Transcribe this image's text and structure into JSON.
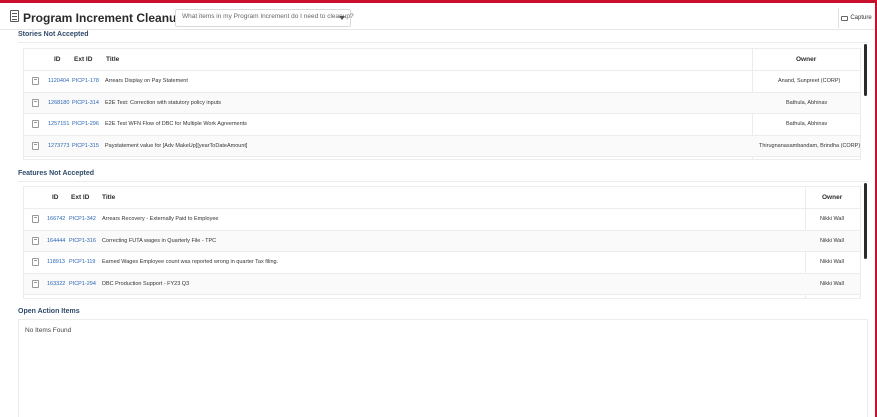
{
  "header": {
    "title": "Program Increment Cleanup Report",
    "dropdown_value": "What items in my Program Increment do I need to cleanup?",
    "capture_label": "Capture",
    "title_icon": "document-icon",
    "capture_icon": "camera-icon"
  },
  "stories": {
    "section_title": "Stories Not Accepted",
    "columns": {
      "id": "ID",
      "ext_id": "Ext ID",
      "title": "Title",
      "owner": "Owner"
    },
    "rows": [
      {
        "id": "1120404",
        "ext_id": "PICP1-178",
        "title": "Arrears Display on Pay Statement",
        "owner": "Anand, Sunpreet (CORP)"
      },
      {
        "id": "1268180",
        "ext_id": "PICP1-314",
        "title": "E2E Test: Correction with statutory policy inputs",
        "owner": "Bathula, Abhinav"
      },
      {
        "id": "1257151",
        "ext_id": "PICP1-296",
        "title": "E2E Test WFN Flow of DBC for Multiple Work Agreements",
        "owner": "Bathula, Abhinav"
      },
      {
        "id": "1273773",
        "ext_id": "PICP1-315",
        "title": "Paystatement value for [Adv MakeUp][yearToDateAmount]",
        "owner": "Thirugnanasambandam, Brindha (CORP)"
      }
    ]
  },
  "features": {
    "section_title": "Features Not Accepted",
    "columns": {
      "id": "ID",
      "ext_id": "Ext ID",
      "title": "Title",
      "owner": "Owner"
    },
    "rows": [
      {
        "id": "166742",
        "ext_id": "PICP1-342",
        "title": "Arrears Recovery - Externally Paid to Employee",
        "owner": "Nikki Wall"
      },
      {
        "id": "164444",
        "ext_id": "PICP1-316",
        "title": "Correcting FUTA wages in Quarterly File - TPC",
        "owner": "Nikki Wall"
      },
      {
        "id": "118913",
        "ext_id": "PICP1-119",
        "title": "Earned Wages Employee count was reported wrong in quarter Tax filing.",
        "owner": "Nikki Wall"
      },
      {
        "id": "163322",
        "ext_id": "PICP1-294",
        "title": "DBC Production Support - FY23 Q3",
        "owner": "Nikki Wall"
      }
    ]
  },
  "action_items": {
    "section_title": "Open Action Items",
    "empty_text": "No Items Found"
  },
  "colors": {
    "accent": "#c8102e",
    "link": "#2a66b6",
    "section_title": "#2f4a6a"
  }
}
